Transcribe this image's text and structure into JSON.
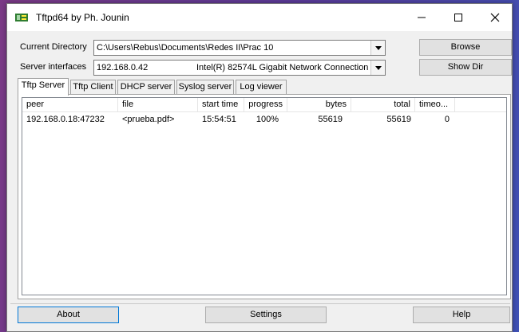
{
  "window": {
    "title": "Tftpd64 by Ph. Jounin"
  },
  "form": {
    "current_directory_label": "Current Directory",
    "current_directory_value": "C:\\Users\\Rebus\\Documents\\Redes II\\Prac 10",
    "server_interfaces_label": "Server interfaces",
    "server_interface_ip": "192.168.0.42",
    "server_interface_name": "Intel(R) 82574L Gigabit Network Connection",
    "browse_label": "Browse",
    "show_dir_label": "Show Dir"
  },
  "tabs": [
    "Tftp Server",
    "Tftp Client",
    "DHCP server",
    "Syslog server",
    "Log viewer"
  ],
  "table": {
    "columns": [
      "peer",
      "file",
      "start time",
      "progress",
      "bytes",
      "total",
      "timeo..."
    ],
    "rows": [
      [
        "192.168.0.18:47232",
        "<prueba.pdf>",
        "15:54:51",
        "100%",
        "55619",
        "55619",
        "0"
      ]
    ]
  },
  "footer": {
    "about": "About",
    "settings": "Settings",
    "help": "Help"
  }
}
